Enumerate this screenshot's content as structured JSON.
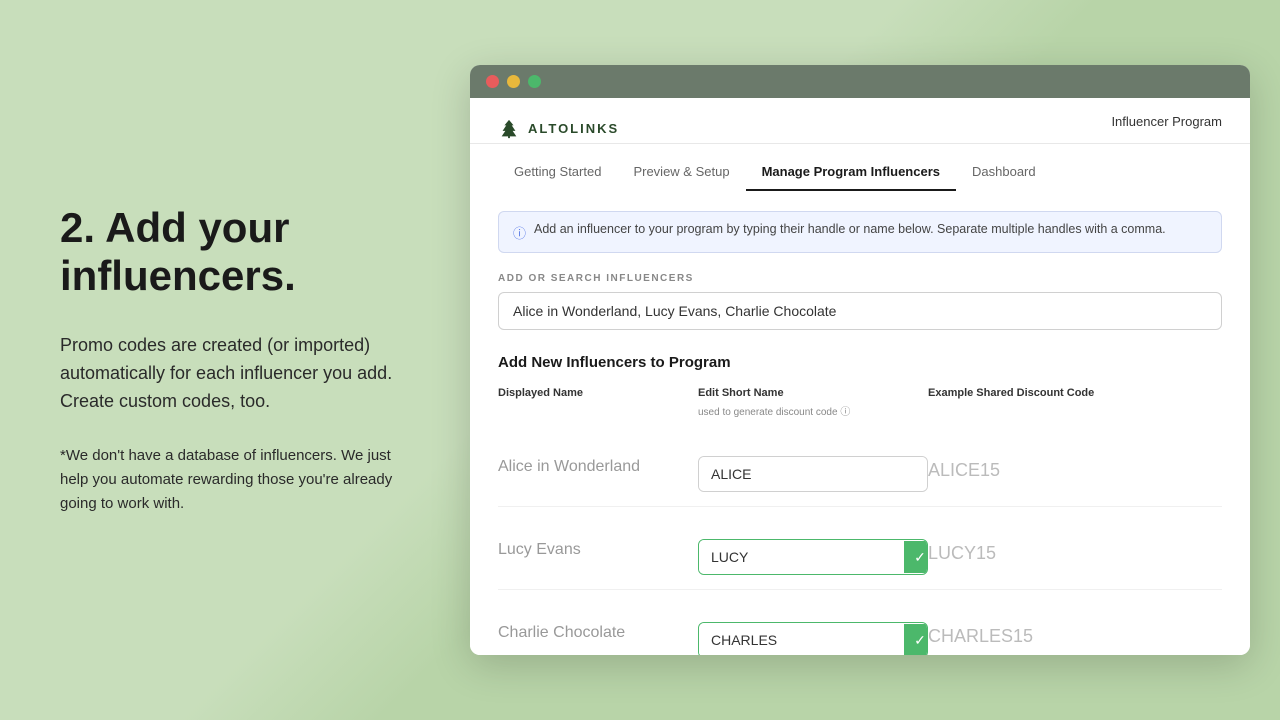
{
  "background": {
    "color": "#cddfc3"
  },
  "left_panel": {
    "heading": "2. Add your influencers.",
    "body_text": "Promo codes are created (or imported) automatically for each influencer you add. Create custom codes, too.",
    "footnote": "*We don't have a database of influencers. We just help you automate rewarding those you're already going to work with."
  },
  "browser": {
    "titlebar": {
      "tl_red": "close",
      "tl_yellow": "minimize",
      "tl_green": "maximize"
    },
    "app": {
      "logo_text": "ALTOLINKS",
      "nav_right": "Influencer Program",
      "tabs": [
        {
          "label": "Getting Started",
          "active": false
        },
        {
          "label": "Preview & Setup",
          "active": false
        },
        {
          "label": "Manage Program Influencers",
          "active": true
        },
        {
          "label": "Dashboard",
          "active": false
        }
      ],
      "info_banner": "Add an influencer to your program by typing their handle or name below. Separate multiple handles with a comma.",
      "search_section_label": "ADD OR SEARCH INFLUENCERS",
      "search_value": "Alice in Wonderland, Lucy Evans, Charlie Chocolate",
      "add_section_title": "Add New Influencers to Program",
      "table": {
        "col1_header": "Displayed Name",
        "col2_header": "Edit Short Name",
        "col2_subheader": "used to generate discount code ⓘ",
        "col3_header": "Example Shared Discount Code",
        "rows": [
          {
            "displayed_name": "Alice in Wonderland",
            "short_name": "ALICE",
            "has_check": false,
            "discount_code": "ALICE15"
          },
          {
            "displayed_name": "Lucy Evans",
            "short_name": "LUCY",
            "has_check": true,
            "discount_code": "LUCY15"
          },
          {
            "displayed_name": "Charlie Chocolate",
            "short_name": "CHARLES",
            "has_check": true,
            "discount_code": "CHARLES15"
          }
        ]
      }
    }
  }
}
